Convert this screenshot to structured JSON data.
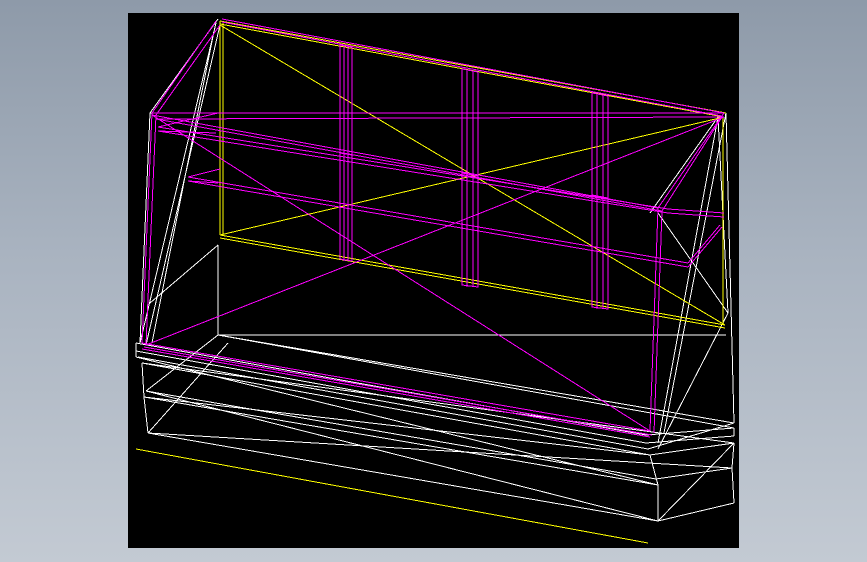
{
  "view": {
    "render_mode": "wireframe",
    "colors": {
      "background": "#000000",
      "outer_gradient_top": "#8e9aa9",
      "outer_gradient_bottom": "#c3cad3",
      "base_frame": "#ffffff",
      "glass_case": "#ff00ff",
      "hidden_edges": "#ffff00"
    }
  }
}
